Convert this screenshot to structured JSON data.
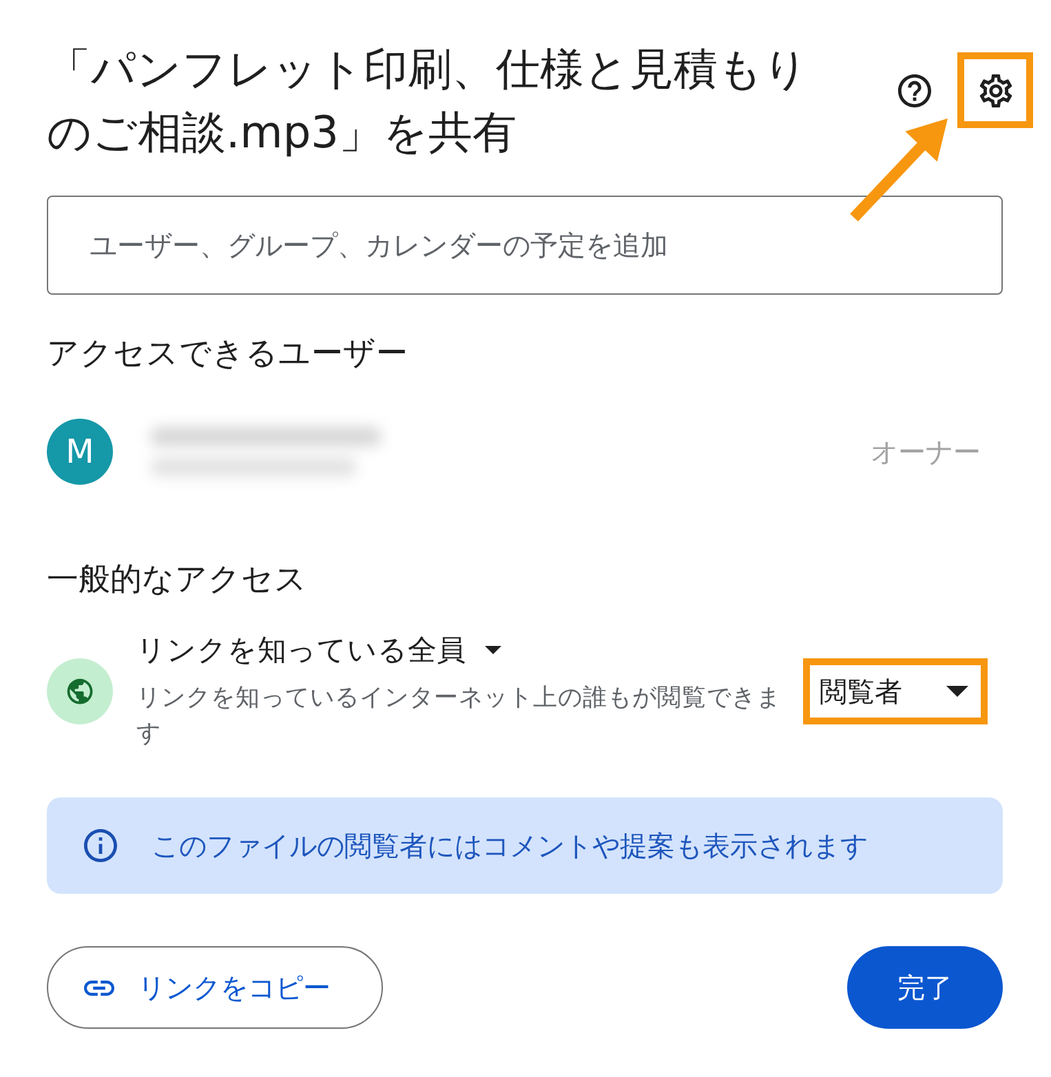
{
  "dialog": {
    "title": "「パンフレット印刷、仕様と見積もりのご相談.mp3」を共有",
    "settings_button": {
      "highlighted": true
    }
  },
  "annotations": {
    "pointer_arrow": true
  },
  "add_people_field": {
    "placeholder": "ユーザー、グループ、カレンダーの予定を追加"
  },
  "people_section": {
    "heading": "アクセスできるユーザー",
    "people": [
      {
        "initial": "M",
        "name_redacted": true,
        "role": "オーナー"
      }
    ]
  },
  "general_access": {
    "heading": "一般的なアクセス",
    "scope": "リンクを知っている全員",
    "description": "リンクを知っているインターネット上の誰もが閲覧できます",
    "role": {
      "label": "閲覧者",
      "highlighted": true
    }
  },
  "notice": {
    "text": "このファイルの閲覧者にはコメントや提案も表示されます"
  },
  "buttons": {
    "copy_link": "リンクをコピー",
    "done": "完了"
  }
}
